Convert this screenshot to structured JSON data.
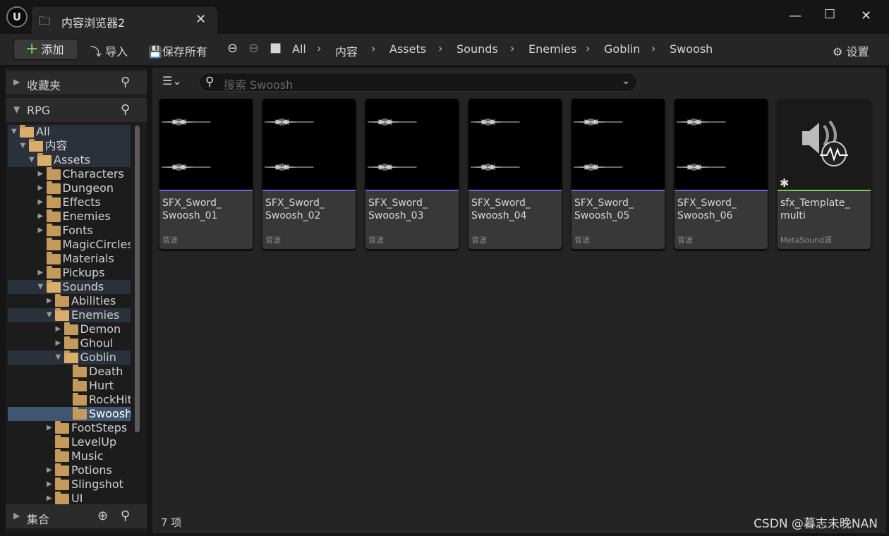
{
  "window": {
    "tab_title": "内容浏览器2",
    "logo": "U"
  },
  "toolbar": {
    "add": "添加",
    "import": "导入",
    "save_all": "保存所有",
    "settings": "设置"
  },
  "breadcrumb": [
    "All",
    "内容",
    "Assets",
    "Sounds",
    "Enemies",
    "Goblin",
    "Swoosh"
  ],
  "left": {
    "favorites": "收藏夹",
    "project": "RPG",
    "collections": "集合"
  },
  "tree": [
    {
      "label": "All",
      "level": 0,
      "arrow": "open",
      "hl": true
    },
    {
      "label": "内容",
      "level": 1,
      "arrow": "open",
      "hl": true
    },
    {
      "label": "Assets",
      "level": 2,
      "arrow": "open",
      "hl": true
    },
    {
      "label": "Characters",
      "level": 3,
      "arrow": "closed"
    },
    {
      "label": "Dungeon",
      "level": 3,
      "arrow": "closed"
    },
    {
      "label": "Effects",
      "level": 3,
      "arrow": "closed"
    },
    {
      "label": "Enemies",
      "level": 3,
      "arrow": "closed"
    },
    {
      "label": "Fonts",
      "level": 3,
      "arrow": "closed"
    },
    {
      "label": "MagicCircles",
      "level": 3,
      "arrow": "none"
    },
    {
      "label": "Materials",
      "level": 3,
      "arrow": "none"
    },
    {
      "label": "Pickups",
      "level": 3,
      "arrow": "closed"
    },
    {
      "label": "Sounds",
      "level": 3,
      "arrow": "open",
      "hl": true
    },
    {
      "label": "Abilities",
      "level": 4,
      "arrow": "closed"
    },
    {
      "label": "Enemies",
      "level": 4,
      "arrow": "open",
      "hl": true
    },
    {
      "label": "Demon",
      "level": 5,
      "arrow": "closed"
    },
    {
      "label": "Ghoul",
      "level": 5,
      "arrow": "closed"
    },
    {
      "label": "Goblin",
      "level": 5,
      "arrow": "open",
      "hl": true
    },
    {
      "label": "Death",
      "level": 6,
      "arrow": "none"
    },
    {
      "label": "Hurt",
      "level": 6,
      "arrow": "none"
    },
    {
      "label": "RockHit",
      "level": 6,
      "arrow": "none"
    },
    {
      "label": "Swoosh",
      "level": 6,
      "arrow": "none",
      "sel": true
    },
    {
      "label": "FootSteps",
      "level": 4,
      "arrow": "closed"
    },
    {
      "label": "LevelUp",
      "level": 4,
      "arrow": "none"
    },
    {
      "label": "Music",
      "level": 4,
      "arrow": "none"
    },
    {
      "label": "Potions",
      "level": 4,
      "arrow": "closed"
    },
    {
      "label": "Slingshot",
      "level": 4,
      "arrow": "closed"
    },
    {
      "label": "UI",
      "level": 4,
      "arrow": "closed"
    }
  ],
  "search": {
    "placeholder": "搜索 Swoosh"
  },
  "assets": [
    {
      "name1": "SFX_Sword_",
      "name2": "Swoosh_01",
      "type": "音波",
      "kind": "wave"
    },
    {
      "name1": "SFX_Sword_",
      "name2": "Swoosh_02",
      "type": "音波",
      "kind": "wave"
    },
    {
      "name1": "SFX_Sword_",
      "name2": "Swoosh_03",
      "type": "音波",
      "kind": "wave"
    },
    {
      "name1": "SFX_Sword_",
      "name2": "Swoosh_04",
      "type": "音波",
      "kind": "wave"
    },
    {
      "name1": "SFX_Sword_",
      "name2": "Swoosh_05",
      "type": "音波",
      "kind": "wave"
    },
    {
      "name1": "SFX_Sword_",
      "name2": "Swoosh_06",
      "type": "音波",
      "kind": "wave"
    },
    {
      "name1": "sfx_Template_",
      "name2": "multi",
      "type": "MetaSound源",
      "kind": "metasound"
    }
  ],
  "colors": {
    "wave": "#7b5ce0",
    "metasound": "#6fd14b"
  },
  "status": {
    "count": "7 项"
  },
  "watermark": "CSDN @暮志未晚NAN"
}
